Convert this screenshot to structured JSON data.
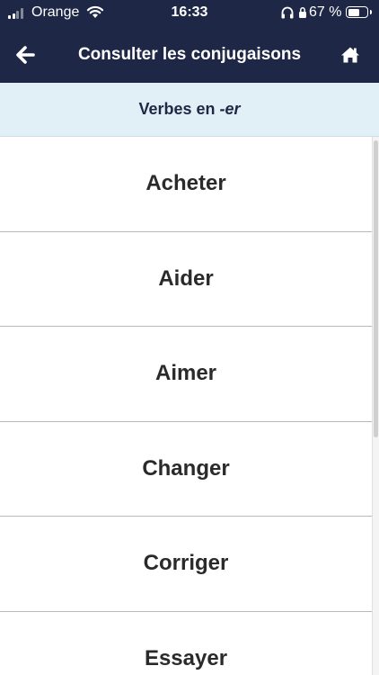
{
  "status_bar": {
    "carrier": "Orange",
    "time": "16:33",
    "battery_percent": "67 %",
    "battery_level": 0.67
  },
  "nav": {
    "title": "Consulter les conjugaisons",
    "back_icon": "arrow-left-icon",
    "home_icon": "home-icon"
  },
  "section": {
    "prefix": "Verbes en ",
    "suffix": "-er"
  },
  "verbs": [
    "Acheter",
    "Aider",
    "Aimer",
    "Changer",
    "Corriger",
    "Essayer"
  ],
  "colors": {
    "header_bg": "#1e2846",
    "banner_bg": "#e1f0f6",
    "row_divider": "#b9b9b9"
  }
}
